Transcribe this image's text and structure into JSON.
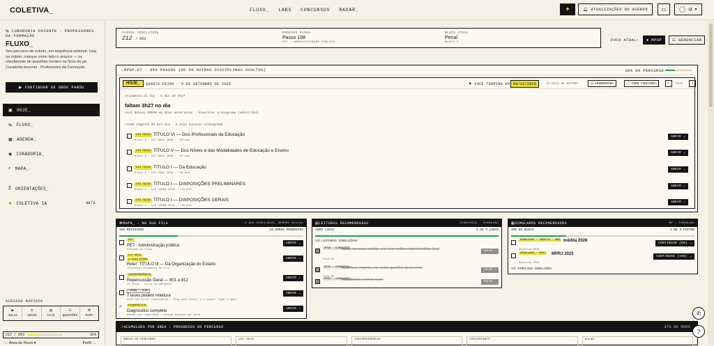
{
  "header": {
    "logo": "COLETIVA_",
    "nav": [
      "FLUXO_",
      "LABS",
      "CONCURSOS",
      "RADAR_"
    ],
    "updates_label": "ATUALIZAÇÕES DO ACERVO",
    "user_label": "qt"
  },
  "sidebar": {
    "kicker": "CURADORIA DOCENTE · PROFESSORES DA FORMAÇÃO",
    "title": "FLUXO_",
    "description": "Seu percurso de estudo, em sequência editorial. Leia na ordem, marque como feito e avance — os checkpoints de questões medem se ficou de pé. Curadoria docente · Professores da Formação.",
    "cta": "CONTINUAR DE ONDE PAROU",
    "items": [
      {
        "label": "HOJE_",
        "icon": "square-icon"
      },
      {
        "label": "FLUXO_",
        "icon": "route-icon"
      },
      {
        "label": "AGENDA_",
        "icon": "calendar-icon"
      },
      {
        "label": "CURADORIA_",
        "icon": "compass-icon"
      },
      {
        "label": "MAPA_",
        "icon": "map-search-icon"
      },
      {
        "label": "ORIENTAÇÕES_",
        "icon": "question-icon"
      },
      {
        "label": "COLETIVA IA",
        "icon": "spark-icon",
        "badge": "BETA"
      }
    ],
    "quick_title": "ACESSOS RÁPIDOS",
    "quick": [
      "AULAS",
      "JURIS",
      "LEIS",
      "QUESTÕES",
      "MAPA"
    ],
    "progress_label": "212 / 853",
    "progress_pct": "32%",
    "progress_value": 0.32,
    "footer_left": "Área do Fluxo",
    "footer_right": "Perfil"
  },
  "stats": {
    "concluidos_label": "PASSOS CONCLUÍDOS",
    "concluidos_value": "212",
    "concluidos_total": "/ 853",
    "proximo_label": "PRÓXIMO PASSO",
    "proximo_value": "Passo 108",
    "proximo_sub": "PE7 · ADMINISTRAÇÃO PÚBLICA",
    "bloco_label": "BLOCO ATUAL",
    "bloco_value": "Penal",
    "bloco_sub": "BLOCO 5"
  },
  "focus": {
    "label": "FOCO ATUAL:",
    "pill": "MPSP",
    "manage": "GERENCIAR"
  },
  "plan": {
    "header": "MPSP-97 · 853 PASSOS (DE 50 OUTRAS DISCIPLINAS OCULTOS)",
    "percent": "36% DO PERCURSO",
    "percent_value": 0.36
  },
  "today": {
    "badge": "HOJE_",
    "date": "QUARTA-FEIRA · 9 DE SETEMBRO DE 2026",
    "term_label": "VOCÊ TERMINA EM",
    "deadline": "08/12/2026",
    "days": "45 DIAS DE ESTUDO",
    "btn_crono": "CRONOGRAMA",
    "btn_como": "COMO FUNCIONA",
    "btn_hoje": "HOJE",
    "line1": "orçamento do dia · 6 min de 3h27",
    "remaining": "faltam 3h27 no dia",
    "line2": "você deixou 00h00 em dias anteriores · Atualizar cronograma redistribui",
    "line3": "ritmo vigente 3h por dia · 6 dias ajustar cronograma",
    "tasks": [
      {
        "tag": "LEI SECA",
        "title": "TÍTULO VI — Dos Profissionais da Educação",
        "sub": "Bloco 3 · LEI 9394 1996 · ~30 min",
        "btn": "ABRIR →"
      },
      {
        "tag": "LEI SECA",
        "title": "TÍTULO V — Dos Níveis e das Modalidades de Educação e Ensino",
        "sub": "Bloco 2 · LEI 9394 1996 · ~45 min",
        "btn": "ABRIR →"
      },
      {
        "tag": "LEI SECA",
        "title": "TÍTULO I — Da Educação",
        "sub": "Bloco 1 · LEI 9394 1996 · ~40 min",
        "btn": "ABRIR →"
      },
      {
        "tag": "LEI SECA",
        "title": "TÍTULO I — DISPOSIÇÕES PRELIMINARES",
        "sub": "Bloco 1 · LEI 13869 2019 · ~40 min",
        "btn": "ABRIR →"
      },
      {
        "tag": "LEI SECA",
        "title": "TÍTULO I — DISPOSIÇÕES GERAIS",
        "sub": "Bloco 1 · LEI 13869 2019 · ~30 min",
        "btn": "ABRIR →"
      }
    ]
  },
  "mapa": {
    "header": "MAPA_ · NA SUA FILA",
    "header_right": "O QUE SIMULADOS, SEMPRE REVISA",
    "sub_left": "32% REVISADOS",
    "sub_right": "10 ERROS PENDENTES",
    "fill": 0.32,
    "items": [
      {
        "tag": "PE7",
        "title": "PE7 · Administração pública",
        "sub": "Próximo do fluxo",
        "btn": "ABRIR →"
      },
      {
        "tag": "LEI SECA",
        "tag2": "3 DIAS ATRÁS",
        "title": "Reler: TÍTULO III — Da Organização do Estado",
        "sub": "revisitar documento de erro",
        "btn": "ABRIR →"
      },
      {
        "tag": "JURISPRUDÊNCIA",
        "title": "Repercussão Geral — 801 a 812",
        "sub": "12 teses · ciclo em pesquisa",
        "btn": "ABRIR →"
      },
      {
        "tag": "TEMAS · TESE",
        "title": "7 teses pedem releitura",
        "sub": "Você vai errar reincidente · Pena Juiz Civil, 4 a seguir ligar e mais",
        "btn": "ABRIR →"
      },
      {
        "tag": "DIAGNÓSTICO",
        "title": "Diagnóstico completo",
        "sub": "Acesso por simulados · estude adiante por área",
        "btn": "ABRIR →"
      }
    ]
  },
  "leituras": {
    "header": "LEITURAS RECOMENDADAS",
    "header_right": "CURADORIA · FORMAÇÃO",
    "sub_left": "100% LIDAS",
    "sub_right": "3 DE 3 LIDAS",
    "fill": 1.0,
    "done_label": "3 LEITURAS CONCLUÍDAS",
    "items": [
      {
        "tag": "DPAS · CURADORIA",
        "title": "CDC - na nossa opinião, a lei com melhor custo-benefício (leia)",
        "sub": "Item 03",
        "btn": "RELER →"
      },
      {
        "tag": "DPAS · CURADORIA",
        "title": "na 1ª fase: importa a lei. treine questões da lei seca.",
        "sub": "Item 02",
        "btn": "RELER →"
      },
      {
        "tag": "DPAS · CURADORIA",
        "title": "Improbidade perfeita muito",
        "sub": "Item 01",
        "btn": "RELER →"
      }
    ]
  },
  "simulados": {
    "header": "SIMULADOS RECOMENDADOS",
    "header_right": "MP · FORMAÇÃO",
    "sub_left": "30% DO BLOCO",
    "sub_right": "1 DE 3 FEITOS",
    "fill": 0.3,
    "items": [
      {
        "tag": "SIMULADOS · INÉDITA · MAS",
        "title": "Inédita 2028",
        "sub": "Objetiva 2024",
        "btn": "CONTINUAR (8%) →"
      },
      {
        "tag": "SIMULADOS · MPRJ",
        "title": "MPRJ 2025",
        "sub": "Objetiva 2025",
        "btn": "CONTINUAR (40%) →"
      }
    ],
    "done_label": "1 SIMULADO CONCLUÍDO"
  },
  "accumulated": {
    "header": "ACUMULADO POR ÁREA · PROGRESSO DO PERCURSO",
    "right": "37% NO MODO",
    "cols": [
      "ÁREAS DO PERCURSO",
      "LEI SECA",
      "JURISPRUDÊNCIA",
      "CHECKPOINTS",
      "AULAS"
    ]
  }
}
